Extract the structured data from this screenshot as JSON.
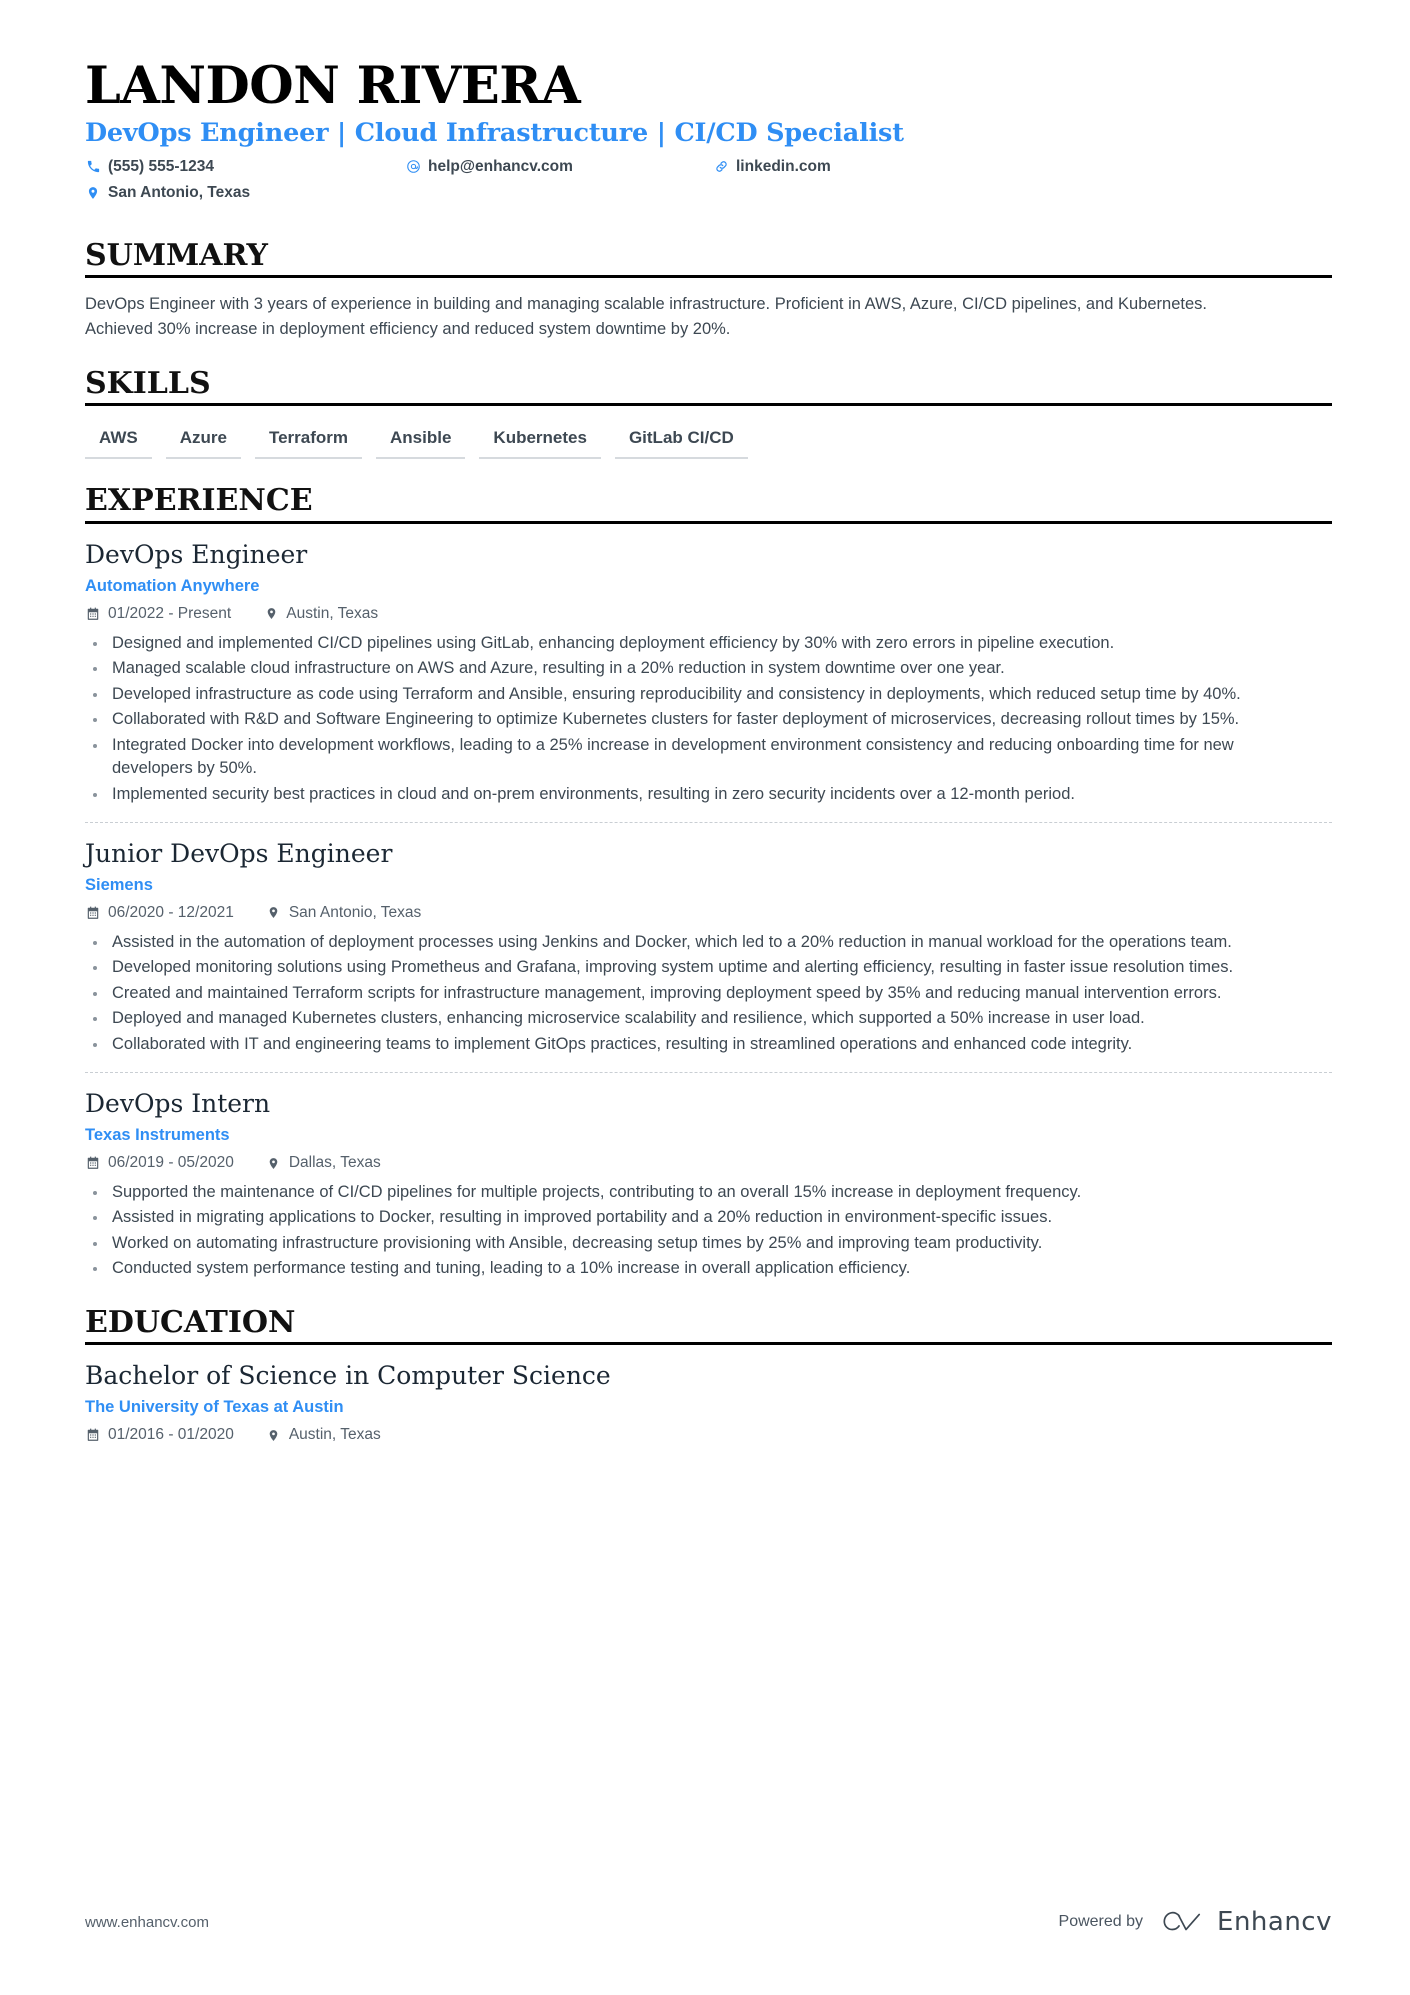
{
  "header": {
    "name": "LANDON RIVERA",
    "subtitle": "DevOps Engineer | Cloud Infrastructure | CI/CD Specialist",
    "contacts": {
      "phone": "(555) 555-1234",
      "email": "help@enhancv.com",
      "link": "linkedin.com",
      "location": "San Antonio, Texas"
    }
  },
  "accent_color": "#2f8ef4",
  "sections": {
    "summary": {
      "title": "SUMMARY",
      "text": "DevOps Engineer with 3 years of experience in building and managing scalable infrastructure. Proficient in AWS, Azure, CI/CD pipelines, and Kubernetes. Achieved 30% increase in deployment efficiency and reduced system downtime by 20%."
    },
    "skills": {
      "title": "SKILLS",
      "items": [
        "AWS",
        "Azure",
        "Terraform",
        "Ansible",
        "Kubernetes",
        "GitLab CI/CD"
      ]
    },
    "experience": {
      "title": "EXPERIENCE",
      "entries": [
        {
          "title": "DevOps Engineer",
          "org": "Automation Anywhere",
          "dates": "01/2022 - Present",
          "location": "Austin, Texas",
          "bullets": [
            "Designed and implemented CI/CD pipelines using GitLab, enhancing deployment efficiency by 30% with zero errors in pipeline execution.",
            "Managed scalable cloud infrastructure on AWS and Azure, resulting in a 20% reduction in system downtime over one year.",
            "Developed infrastructure as code using Terraform and Ansible, ensuring reproducibility and consistency in deployments, which reduced setup time by 40%.",
            "Collaborated with R&D and Software Engineering to optimize Kubernetes clusters for faster deployment of microservices, decreasing rollout times by 15%.",
            "Integrated Docker into development workflows, leading to a 25% increase in development environment consistency and reducing onboarding time for new developers by 50%.",
            "Implemented security best practices in cloud and on-prem environments, resulting in zero security incidents over a 12-month period."
          ]
        },
        {
          "title": "Junior DevOps Engineer",
          "org": "Siemens",
          "dates": "06/2020 - 12/2021",
          "location": "San Antonio, Texas",
          "bullets": [
            "Assisted in the automation of deployment processes using Jenkins and Docker, which led to a 20% reduction in manual workload for the operations team.",
            "Developed monitoring solutions using Prometheus and Grafana, improving system uptime and alerting efficiency, resulting in faster issue resolution times.",
            "Created and maintained Terraform scripts for infrastructure management, improving deployment speed by 35% and reducing manual intervention errors.",
            "Deployed and managed Kubernetes clusters, enhancing microservice scalability and resilience, which supported a 50% increase in user load.",
            "Collaborated with IT and engineering teams to implement GitOps practices, resulting in streamlined operations and enhanced code integrity."
          ]
        },
        {
          "title": "DevOps Intern",
          "org": "Texas Instruments",
          "dates": "06/2019 - 05/2020",
          "location": "Dallas, Texas",
          "bullets": [
            "Supported the maintenance of CI/CD pipelines for multiple projects, contributing to an overall 15% increase in deployment frequency.",
            "Assisted in migrating applications to Docker, resulting in improved portability and a 20% reduction in environment-specific issues.",
            "Worked on automating infrastructure provisioning with Ansible, decreasing setup times by 25% and improving team productivity.",
            "Conducted system performance testing and tuning, leading to a 10% increase in overall application efficiency."
          ]
        }
      ]
    },
    "education": {
      "title": "EDUCATION",
      "entries": [
        {
          "title": "Bachelor of Science in Computer Science",
          "org": "The University of Texas at Austin",
          "dates": "01/2016 - 01/2020",
          "location": "Austin, Texas"
        }
      ]
    }
  },
  "footer": {
    "url": "www.enhancv.com",
    "powered_by": "Powered by",
    "brand": "Enhancv"
  }
}
